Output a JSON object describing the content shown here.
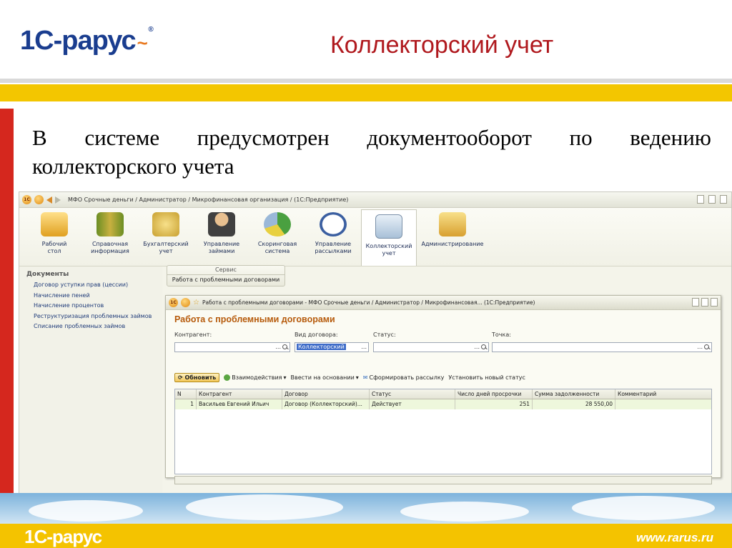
{
  "slide": {
    "logo": "1С-рарус",
    "title": "Коллекторский учет",
    "body_line1": [
      "В",
      "системе",
      "предусмотрен",
      "документооборот",
      "по",
      "ведению"
    ],
    "body_line2": "коллекторского учета",
    "footer_logo": "1С-рарус",
    "site": "www.rarus.ru"
  },
  "app": {
    "title": "МФО Срочные деньги / Администратор / Микрофинансовая организация / (1С:Предприятие)",
    "sections": [
      {
        "l1": "Рабочий",
        "l2": "стол"
      },
      {
        "l1": "Справочная",
        "l2": "информация"
      },
      {
        "l1": "Бухгалтерский",
        "l2": "учет"
      },
      {
        "l1": "Управление",
        "l2": "займами"
      },
      {
        "l1": "Скоринговая",
        "l2": "система"
      },
      {
        "l1": "Управление",
        "l2": "рассылками"
      },
      {
        "l1": "Коллекторский",
        "l2": "учет"
      },
      {
        "l1": "Администрирование",
        "l2": ""
      }
    ],
    "nav_heading": "Документы",
    "nav_items": [
      "Договор уступки прав (цессии)",
      "Начисление пеней",
      "Начисление процентов",
      "Реструктуризация проблемных займов",
      "Списание проблемных займов"
    ],
    "service_heading": "Сервис",
    "service_item": "Работа с проблемными договорами"
  },
  "window": {
    "title": "Работа с проблемными договорами - МФО Срочные деньги / Администратор / Микрофинансовая... (1С:Предприятие)",
    "form_title": "Работа с проблемными договорами",
    "labels": {
      "kontragent": "Контрагент:",
      "vid": "Вид договора:",
      "status": "Статус:",
      "tochka": "Точка:"
    },
    "vid_value": "Коллекторский",
    "toolbar": {
      "update": "Обновить",
      "vzaim": "Взаимодействия",
      "vvesti": "Ввести на основании",
      "rassylka": "Сформировать рассылку",
      "status": "Установить новый статус"
    },
    "columns": [
      "N",
      "Контрагент",
      "Договор",
      "Статус",
      "Число дней просрочки",
      "Сумма задолженности",
      "Комментарий"
    ],
    "rows": [
      [
        "1",
        "Васильев Евгений Ильич",
        "Договор (Коллекторский)...",
        "Действует",
        "251",
        "28 550,00",
        ""
      ]
    ]
  }
}
